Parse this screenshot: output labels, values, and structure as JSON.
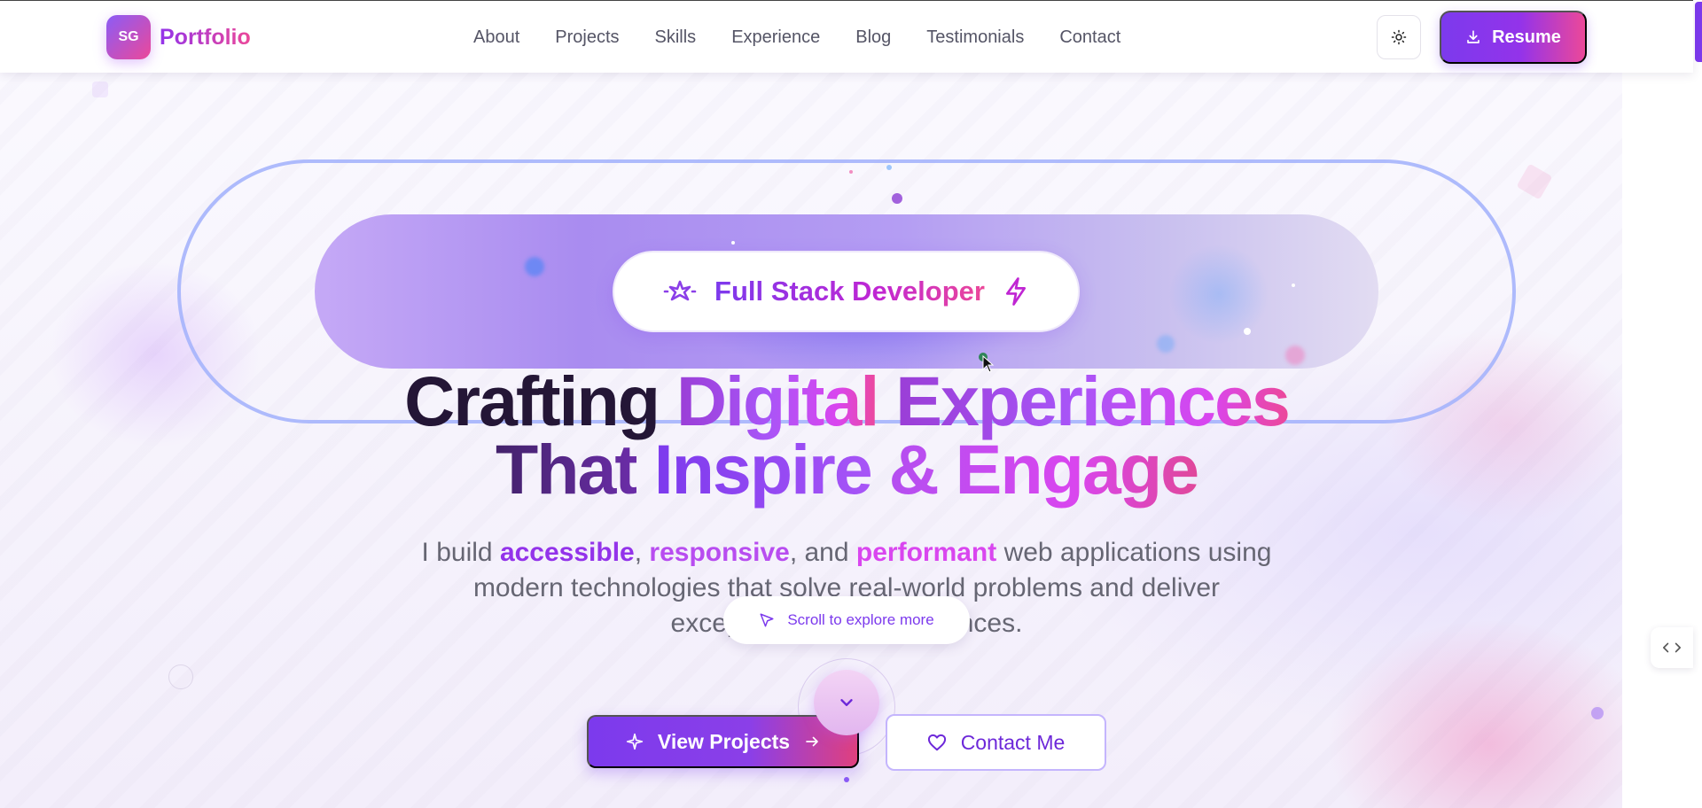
{
  "brand": {
    "initials": "SG",
    "name": "Portfolio",
    "colors": {
      "primary": "#7c3aed",
      "accent": "#ec4899"
    }
  },
  "nav": {
    "links": [
      "About",
      "Projects",
      "Skills",
      "Experience",
      "Blog",
      "Testimonials",
      "Contact"
    ]
  },
  "header_actions": {
    "theme_toggle_icon": "sun-icon",
    "resume_label": "Resume",
    "resume_icon": "download-icon"
  },
  "hero": {
    "role_badge": {
      "label": "Full Stack Developer",
      "left_icon": "sparkle-icon",
      "right_icon": "lightning-icon"
    },
    "headline": {
      "line1": {
        "word1": "Crafting",
        "word2": "Digital",
        "word3": "Experiences"
      },
      "line2": {
        "word1": "That",
        "word2": "Inspire",
        "word3": "& Engage"
      }
    },
    "subtext": {
      "part1": "I build ",
      "kw1": "accessible",
      "part2": ", ",
      "kw2": "responsive",
      "part3": ", and ",
      "kw3": "performant",
      "part4": " web applications using modern technologies that solve real-world problems and deliver exceptional user experiences."
    },
    "scroll_hint": {
      "label": "Scroll to explore more",
      "icon": "cursor-pointer-icon",
      "chevron_icon": "chevron-down-icon"
    },
    "cta_primary": {
      "label": "View Projects",
      "left_icon": "sparkle-icon",
      "right_icon": "arrow-right-icon"
    },
    "cta_secondary": {
      "label": "Contact Me",
      "icon": "heart-icon"
    }
  },
  "side_tab": {
    "icon": "code-icon"
  }
}
